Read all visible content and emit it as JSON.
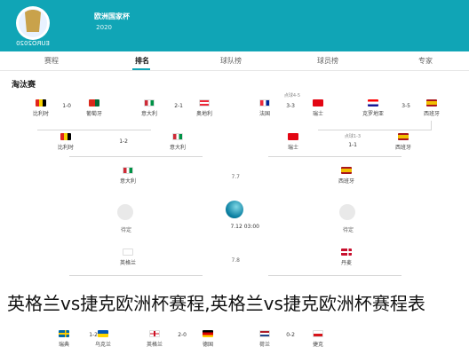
{
  "app": {
    "title": "欧洲国家杯",
    "subtitle": "2020"
  },
  "tabs": [
    "赛程",
    "排名",
    "球队榜",
    "球员榜",
    "专家"
  ],
  "section_title": "淘汰赛",
  "round16": [
    {
      "left": {
        "name": "比利时",
        "flag": "be"
      },
      "right": {
        "name": "葡萄牙",
        "flag": "pt"
      },
      "score": "1-0"
    },
    {
      "left": {
        "name": "意大利",
        "flag": "it"
      },
      "right": {
        "name": "奥地利",
        "flag": "at"
      },
      "score": "2-1"
    },
    {
      "left": {
        "name": "法国",
        "flag": "fr"
      },
      "right": {
        "name": "瑞士",
        "flag": "ch"
      },
      "score": "3-3",
      "note": "点球4-5"
    },
    {
      "left": {
        "name": "克罗地亚",
        "flag": "hr"
      },
      "right": {
        "name": "西班牙",
        "flag": "es"
      },
      "score": "3-5"
    }
  ],
  "quarter": [
    {
      "left": {
        "name": "比利时",
        "flag": "be"
      },
      "right": {
        "name": "意大利",
        "flag": "it"
      },
      "score": "1-2"
    },
    {
      "left": {
        "name": "瑞士",
        "flag": "ch"
      },
      "right": {
        "name": "西班牙",
        "flag": "es"
      },
      "score": "1-1",
      "note": "点球1-3"
    }
  ],
  "semi": [
    {
      "team": {
        "name": "意大利",
        "flag": "it"
      },
      "date": "7.7"
    },
    {
      "team": {
        "name": "西班牙",
        "flag": "es"
      },
      "date": "7.7"
    }
  ],
  "final": {
    "left_label": "待定",
    "right_label": "待定",
    "datetime": "7.12 03:00"
  },
  "semi2": [
    {
      "team": {
        "name": "英格兰",
        "flag": "en"
      },
      "date": "7.8"
    },
    {
      "team": {
        "name": "丹麦",
        "flag": "dk"
      },
      "date": "7.8"
    }
  ],
  "bottom": [
    {
      "name": "瑞典",
      "flag": "se"
    },
    {
      "name": "乌克兰",
      "flag": "ua"
    },
    {
      "score": "1-2"
    },
    {
      "name": "英格兰",
      "flag": "en"
    },
    {
      "score": "2-0"
    },
    {
      "name": "德国",
      "flag": "de"
    },
    {
      "name": "荷兰",
      "flag": "nl"
    },
    {
      "score": "0-2"
    },
    {
      "name": "捷克",
      "flag": "cz"
    }
  ],
  "watermark": "英格兰vs捷克欧洲杯赛程,英格兰vs捷克欧洲杯赛程表",
  "colors": {
    "topbar": "#10a5b6"
  }
}
